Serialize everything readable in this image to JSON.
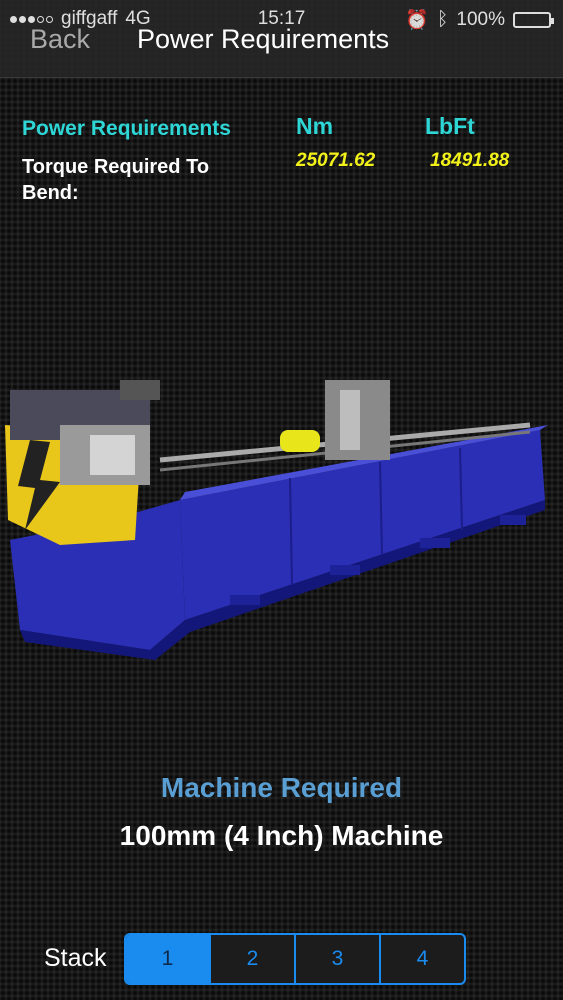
{
  "status_bar": {
    "carrier": "giffgaff",
    "network": "4G",
    "time": "15:17",
    "battery": "100%"
  },
  "nav": {
    "back_label": "Back",
    "title": "Power Requirements"
  },
  "requirements": {
    "heading": "Power Requirements",
    "unit_nm": "Nm",
    "unit_lbft": "LbFt",
    "torque_label": "Torque Required To Bend:",
    "torque_nm": "25071.62",
    "torque_lbft": "18491.88"
  },
  "machine": {
    "required_label": "Machine Required",
    "name": "100mm (4 Inch) Machine"
  },
  "stack": {
    "label": "Stack",
    "options": [
      "1",
      "2",
      "3",
      "4"
    ],
    "selected": "1"
  },
  "colors": {
    "accent_cyan": "#2ed6d6",
    "value_yellow": "#f2f21a",
    "machine_blue": "#2a2fb5",
    "segment_blue": "#1a8cf0"
  }
}
